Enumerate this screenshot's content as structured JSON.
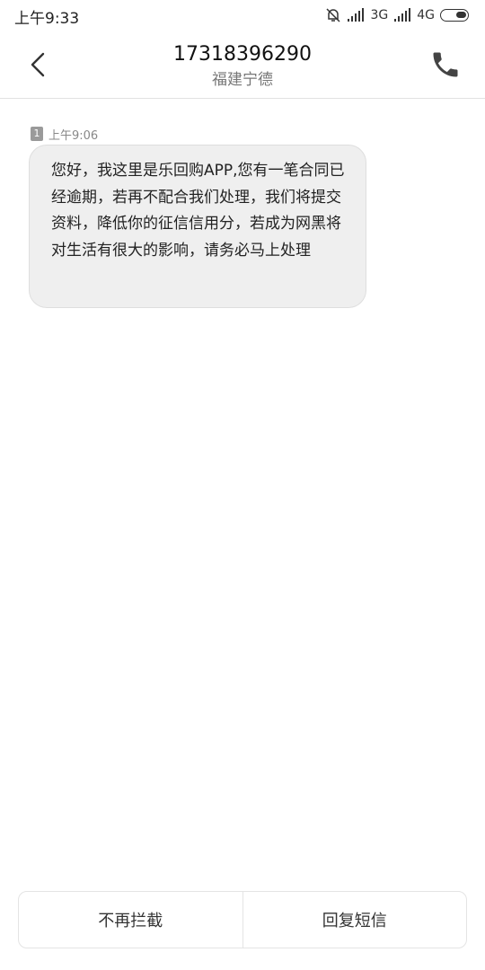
{
  "status_bar": {
    "time": "上午9:33",
    "network1": "3G",
    "network2": "4G",
    "icons": [
      "mute-bell-icon",
      "signal-icon",
      "signal-icon",
      "battery-icon"
    ]
  },
  "header": {
    "title": "17318396290",
    "subtitle": "福建宁德",
    "icons": [
      "back-arrow-icon",
      "phone-icon"
    ]
  },
  "message": {
    "sim": "1",
    "time": "上午9:06",
    "body": "您好，我这里是乐回购APP,您有一笔合同已经逾期，若再不配合我们处理，我们将提交资料，降低你的征信信用分，若成为网黑将对生活有很大的影响，请务必马上处理"
  },
  "bottom_actions": {
    "block_label": "不再拦截",
    "reply_label": "回复短信"
  }
}
